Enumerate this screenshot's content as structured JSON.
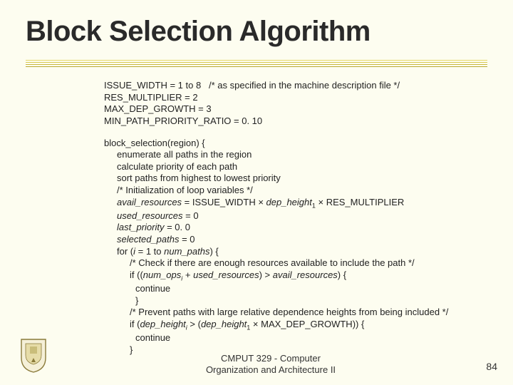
{
  "title": "Block Selection Algorithm",
  "params": {
    "issue_width": "ISSUE_WIDTH = 1 to 8   /* as specified in the machine description file */",
    "res_multiplier": "RES_MULTIPLIER = 2",
    "max_dep_growth": "MAX_DEP_GROWTH = 3",
    "min_path_priority_ratio": "MIN_PATH_PRIORITY_RATIO = 0. 10"
  },
  "algo": {
    "fn_open": "block_selection(region) {",
    "enum_paths": "enumerate all paths in the region",
    "calc_priority": "calculate priority of each path",
    "sort_paths": "sort paths from highest to lowest priority",
    "init_comment": "/* Initialization of loop variables */",
    "avail_lhs": "avail_resources",
    "avail_eq": " = ISSUE_WIDTH × ",
    "dep_height": "dep_height",
    "avail_rhs": " × RES_MULTIPLIER",
    "used_lhs": "used_resources",
    "used_rhs": " = 0",
    "last_lhs": "last_priority",
    "last_rhs": " = 0. 0",
    "sel_lhs": "selected_paths",
    "sel_rhs": " = 0",
    "for_pre": "for (",
    "for_var": "i",
    "for_mid": " = 1 to ",
    "for_np": "num_paths",
    "for_post": ") {",
    "check_comment": "/* Check if there are enough resources available to include the path */",
    "if1_pre": "if ((",
    "num_ops": "num_ops",
    "if1_mid1": " + ",
    "used_res2": "used_resources",
    "if1_mid2": ") > ",
    "avail_res2": "avail_resources",
    "if1_post": ") {",
    "continue1": "continue",
    "close1": "}",
    "prevent_comment": "/* Prevent paths with large relative dependence heights from being included */",
    "if2_pre": "if (",
    "if2_mid": " > (",
    "if2_tail": " × MAX_DEP_GROWTH)) {",
    "continue2": "continue",
    "close2": "}"
  },
  "footer": {
    "course1": "CMPUT 329 - Computer",
    "course2": "Organization and Architecture II",
    "page": "84"
  }
}
